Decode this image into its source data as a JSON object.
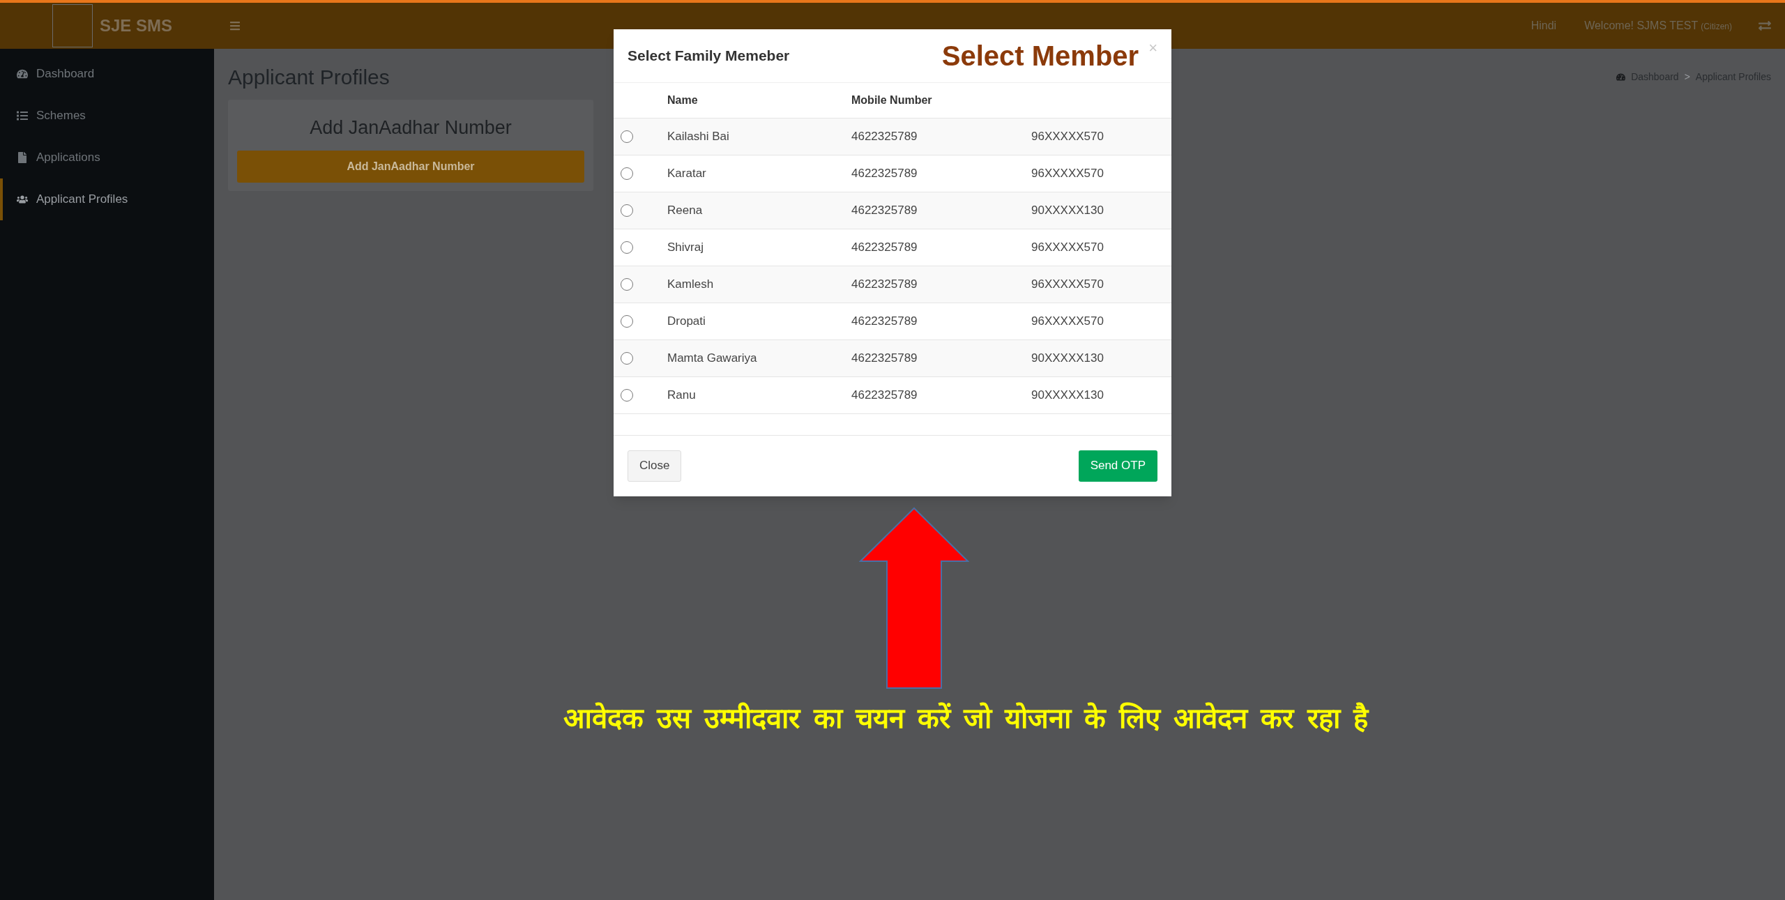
{
  "topbar": {
    "brand": "SJE SMS",
    "language": "Hindi",
    "welcome": "Welcome! SJMS TEST",
    "role": "(Citizen)"
  },
  "sidebar": {
    "items": [
      {
        "label": "Dashboard",
        "selected": false
      },
      {
        "label": "Schemes",
        "selected": false
      },
      {
        "label": "Applications",
        "selected": false
      },
      {
        "label": "Applicant Profiles",
        "selected": true
      }
    ]
  },
  "page": {
    "title": "Applicant Profiles",
    "breadcrumb": [
      "Dashboard",
      ">",
      "Applicant Profiles"
    ],
    "card": {
      "title": "Add JanAadhar Number",
      "button": "Add JanAadhar Number"
    }
  },
  "modal": {
    "title": "Select Family Memeber",
    "annotation": "Select Member",
    "close_icon": "×",
    "table": {
      "columns": [
        "Name",
        "Mobile Number"
      ],
      "rows": [
        {
          "selected": false,
          "name": "Kailashi Bai",
          "mobile": "4622325789",
          "column_3": "96XXXXX570"
        },
        {
          "selected": false,
          "name": "Karatar",
          "mobile": "4622325789",
          "column_3": "96XXXXX570"
        },
        {
          "selected": false,
          "name": "Reena",
          "mobile": "4622325789",
          "column_3": "90XXXXX130"
        },
        {
          "selected": false,
          "name": "Shivraj",
          "mobile": "4622325789",
          "column_3": "96XXXXX570"
        },
        {
          "selected": false,
          "name": "Kamlesh",
          "mobile": "4622325789",
          "column_3": "96XXXXX570"
        },
        {
          "selected": false,
          "name": "Dropati",
          "mobile": "4622325789",
          "column_3": "96XXXXX570"
        },
        {
          "selected": false,
          "name": "Mamta Gawariya",
          "mobile": "4622325789",
          "column_3": "90XXXXX130"
        },
        {
          "selected": false,
          "name": "Ranu",
          "mobile": "4622325789",
          "column_3": "90XXXXX130"
        }
      ]
    },
    "buttons": {
      "close": "Close",
      "send": "Send OTP"
    }
  },
  "annotation_text": "आवेदक उस उम्मीदवार का चयन करें जो योजना के लिए आवेदन कर रहा है"
}
